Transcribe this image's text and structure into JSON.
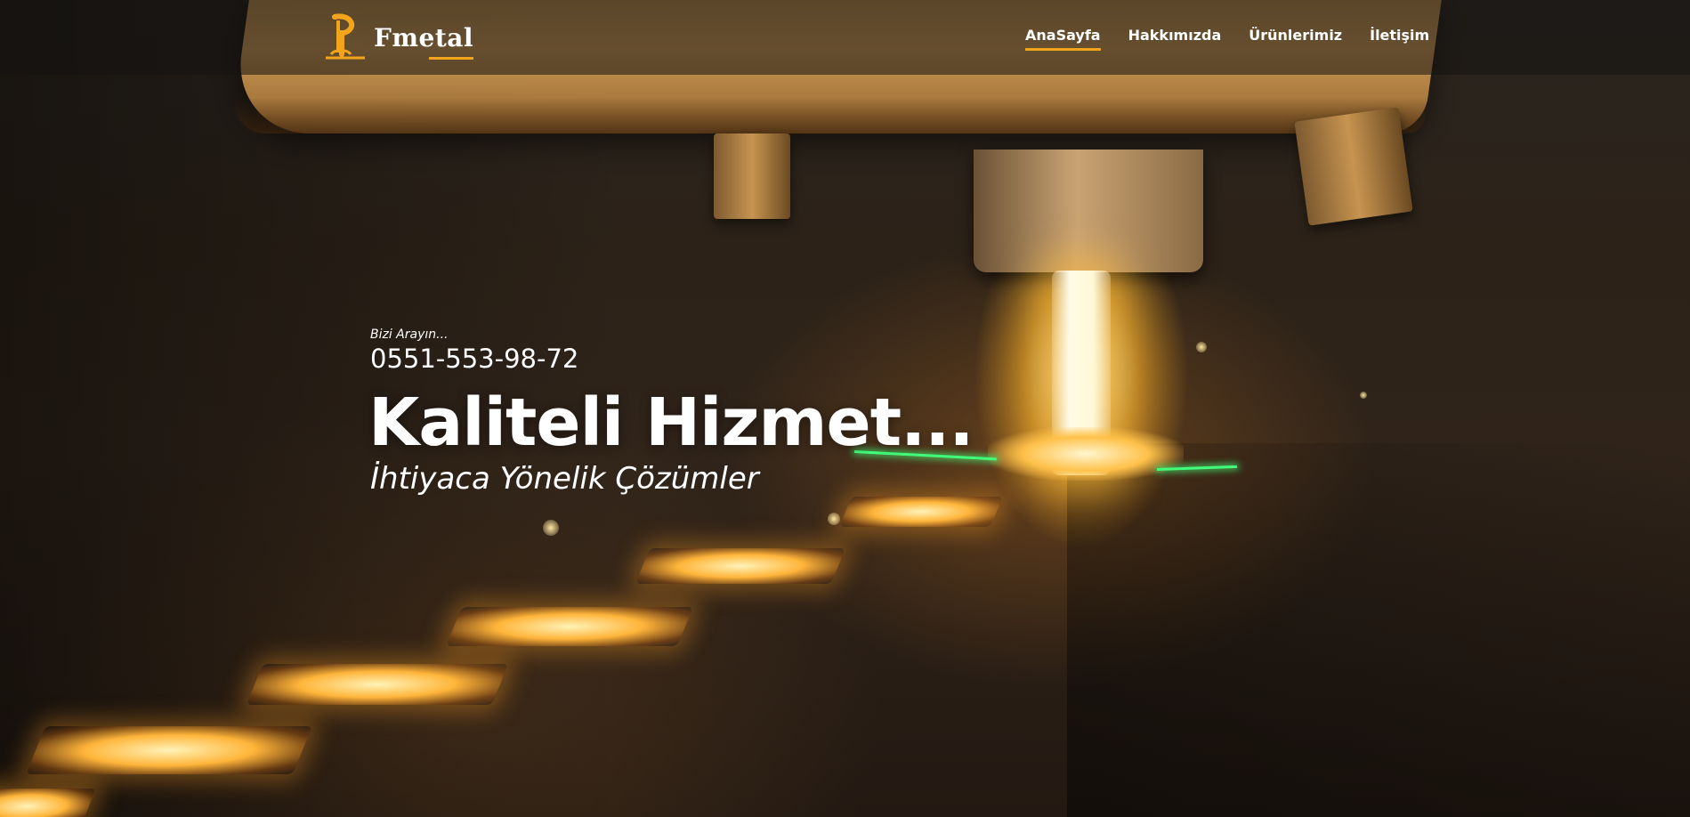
{
  "brand": {
    "name": "Fmetal",
    "accent": "#f2a51a"
  },
  "nav": {
    "items": [
      {
        "label": "AnaSayfa",
        "active": true
      },
      {
        "label": "Hakkımızda",
        "active": false
      },
      {
        "label": "Ürünlerimiz",
        "active": false
      },
      {
        "label": "İletişim",
        "active": false
      }
    ]
  },
  "hero": {
    "call_label": "Bizi Arayın...",
    "phone": "0551-553-98-72",
    "headline": "Kaliteli Hizmet...",
    "tagline": "İhtiyaca Yönelik Çözümler",
    "background": "metal-cutting-machine-photo"
  }
}
